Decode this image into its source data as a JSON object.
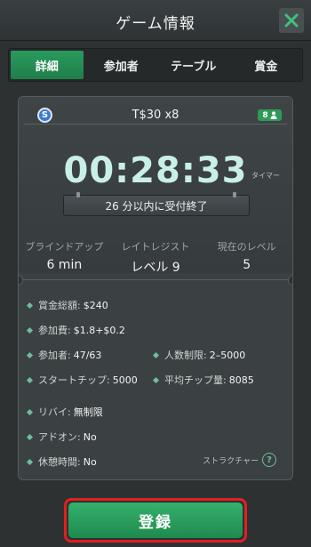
{
  "header": {
    "title": "ゲーム情報"
  },
  "tabs": [
    {
      "label": "詳細",
      "active": true
    },
    {
      "label": "参加者",
      "active": false
    },
    {
      "label": "テーブル",
      "active": false
    },
    {
      "label": "賞金",
      "active": false
    }
  ],
  "game": {
    "currency_icon": "S",
    "name": "T$30 x8",
    "seat_count": "8",
    "timer": "00:28:33",
    "timer_label": "タイマー",
    "notice": "26 分以内に受付終了"
  },
  "stats": [
    {
      "label": "ブラインドアップ",
      "value": "6 min"
    },
    {
      "label": "レイトレジスト",
      "value": "レベル 9"
    },
    {
      "label": "現在のレベル",
      "value": "5"
    }
  ],
  "details": {
    "prize_pool": {
      "label": "賞金総額:",
      "value": "$240"
    },
    "entry_fee": {
      "label": "参加費:",
      "value": "$1.8+$0.2"
    },
    "entrants": {
      "label": "参加者:",
      "value": "47/63"
    },
    "player_limit": {
      "label": "人数制限:",
      "value": "2–5000"
    },
    "starting_chips": {
      "label": "スタートチップ:",
      "value": "5000"
    },
    "avg_chips": {
      "label": "平均チップ量:",
      "value": "8085"
    },
    "rebuy": {
      "label": "リバイ:",
      "value": "無制限"
    },
    "addon": {
      "label": "アドオン:",
      "value": "No"
    },
    "break": {
      "label": "休憩時間:",
      "value": "No"
    },
    "structure_label": "ストラクチャー"
  },
  "register_label": "登録",
  "colors": {
    "accent": "#2a9a5e",
    "highlight": "#e02020",
    "timer": "#c8f0e6"
  }
}
